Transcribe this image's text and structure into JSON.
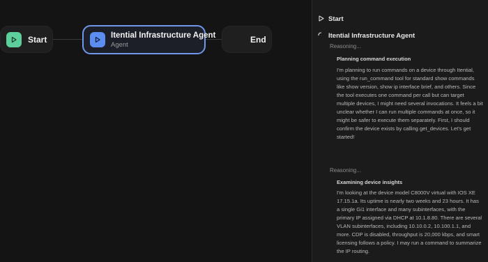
{
  "workflow": {
    "nodes": {
      "start": {
        "label": "Start",
        "icon": "play-icon"
      },
      "agent": {
        "title": "Itential Infrastructure Agent",
        "subtitle": "Agent",
        "icon": "play-icon"
      },
      "end": {
        "label": "End"
      }
    }
  },
  "panel": {
    "start_label": "Start",
    "agent_label": "Itential Infrastructure Agent",
    "entries": [
      {
        "status": "Reasoning...",
        "title": "Planning command execution",
        "body": "I'm planning to run commands on a device through Itential, using the run_command tool for standard show commands like show version, show ip interface brief, and others. Since the tool executes one command per call but can target multiple devices, I might need several invocations. It feels a bit unclear whether I can run multiple commands at once, so it might be safer to execute them separately. First, I should confirm the device exists by calling get_devices. Let's get started!"
      },
      {
        "status": "Reasoning...",
        "title": "Examining device insights",
        "body": "I'm looking at the device model C8000V virtual with IOS XE 17.15.1a. Its uptime is nearly two weeks and 23 hours. It has a single Gi1 interface and many subinterfaces, with the primary IP assigned via DHCP at 10.1.8.80. There are several VLAN subinterfaces, including 10.10.0.2, 10.100.1.1, and more. CDP is disabled, throughput is 20,000 kbps, and smart licensing follows a policy. I may run a command to summarize the IP routing."
      }
    ]
  },
  "colors": {
    "start_icon": "#5ccf9a",
    "agent_icon": "#5b8ef0",
    "agent_border": "#6f97ea"
  }
}
